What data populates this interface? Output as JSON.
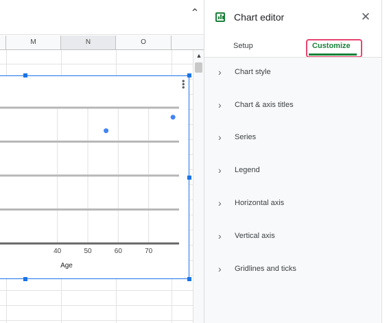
{
  "sheet": {
    "columns": [
      "M",
      "N",
      "O"
    ],
    "selected_column": "N"
  },
  "chart_data": {
    "type": "scatter",
    "xlabel": "Age",
    "x_ticks": [
      40,
      50,
      60,
      70
    ],
    "xlim": [
      20,
      80
    ],
    "points": [
      {
        "x": 56,
        "y": 0.83
      },
      {
        "x": 78,
        "y": 0.93
      }
    ],
    "point_color": "#4285f4",
    "grid": true
  },
  "editor": {
    "title": "Chart editor",
    "tabs": [
      {
        "label": "Setup",
        "active": false
      },
      {
        "label": "Customize",
        "active": true
      }
    ],
    "sections": [
      {
        "label": "Chart style"
      },
      {
        "label": "Chart & axis titles"
      },
      {
        "label": "Series"
      },
      {
        "label": "Legend"
      },
      {
        "label": "Horizontal axis"
      },
      {
        "label": "Vertical axis"
      },
      {
        "label": "Gridlines and ticks"
      }
    ]
  },
  "icons": {
    "collapse": "chevron-up-icon",
    "scroll_up": "scroll-up-arrow-icon",
    "chart_menu": "more-vert-icon",
    "editor": "chart-icon",
    "close": "close-icon",
    "section_toggle": "chevron-right-icon"
  },
  "colors": {
    "accent_green": "#188038",
    "selection_blue": "#1a73e8",
    "highlight_pink": "#e8436f"
  }
}
